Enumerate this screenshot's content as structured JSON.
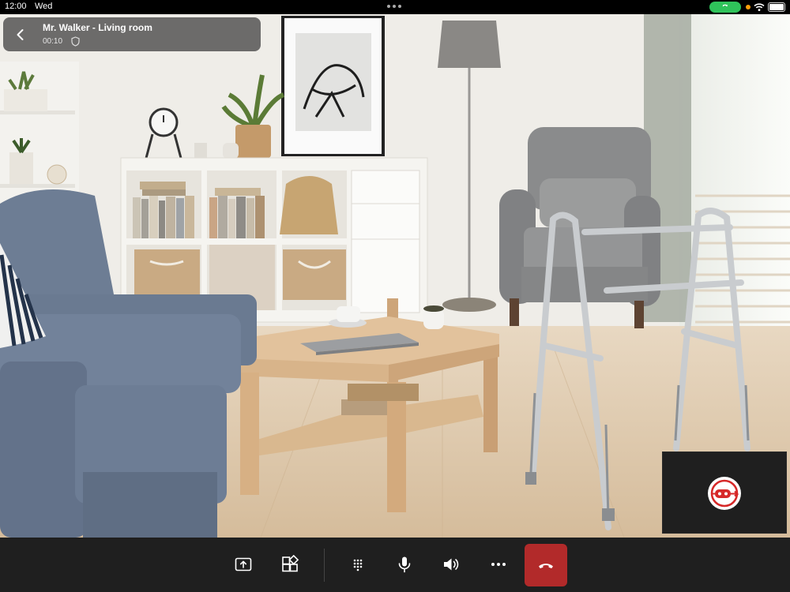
{
  "status_bar": {
    "time": "12:00",
    "day": "Wed",
    "call_indicator_color": "#2fc35a"
  },
  "call": {
    "title": "Mr. Walker - Living room",
    "duration": "00:10",
    "back_icon": "chevron-left-icon",
    "security_icon": "shield-icon"
  },
  "self_view": {
    "avatar_icon": "robot-logo-icon",
    "avatar_color": "#d62828"
  },
  "controls": [
    {
      "name": "share-screen-button",
      "icon": "share-tray-icon"
    },
    {
      "name": "apps-button",
      "icon": "apps-grid-icon"
    },
    {
      "name": "dialpad-button",
      "icon": "dialpad-icon"
    },
    {
      "name": "microphone-button",
      "icon": "microphone-icon"
    },
    {
      "name": "speaker-button",
      "icon": "speaker-icon"
    },
    {
      "name": "more-options-button",
      "icon": "more-horizontal-icon"
    },
    {
      "name": "end-call-button",
      "icon": "phone-hangup-icon",
      "color": "#b22a2a"
    }
  ]
}
